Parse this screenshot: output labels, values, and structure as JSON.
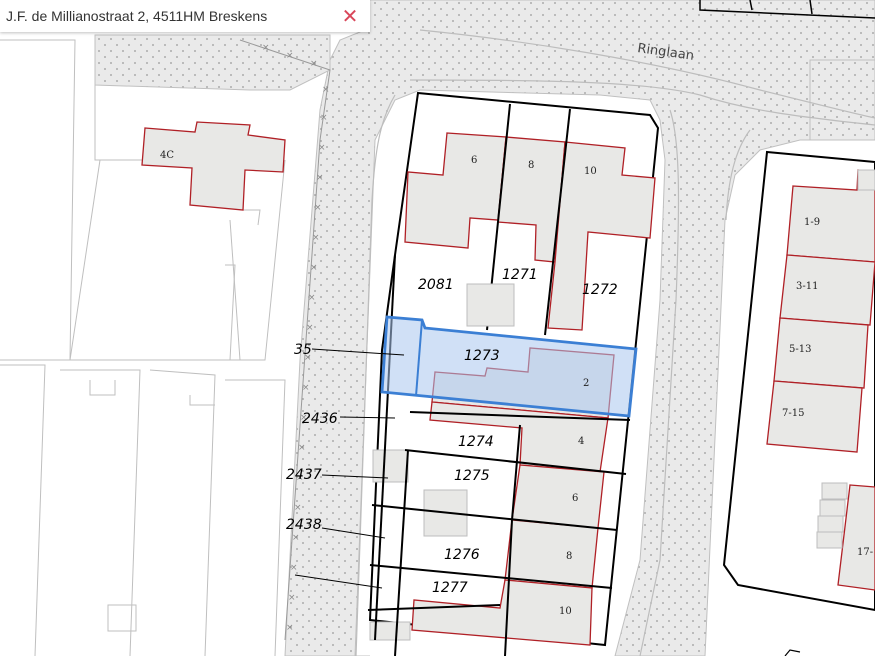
{
  "search": {
    "address": "J.F. de Millianostraat 2, 4511HM Breskens",
    "close_icon": "close-icon",
    "close_color": "#d9475a"
  },
  "map": {
    "street_name": "Ringlaan",
    "selected_parcel": "1273",
    "colors": {
      "selection_fill": "#cfe0f7",
      "selection_stroke": "#3b7fd4",
      "building_fill": "#e8e8e6",
      "building_stroke": "#b02026",
      "public_space": "#e9e9e9"
    },
    "parcel_labels": [
      "2081",
      "1271",
      "1272",
      "1273",
      "1274",
      "1275",
      "1276",
      "1277",
      "2436",
      "35",
      "2437",
      "2438"
    ],
    "house_numbers": [
      "4C",
      "6",
      "8",
      "10",
      "2",
      "4",
      "6",
      "8",
      "10",
      "1-9",
      "3-11",
      "5-13",
      "7-15",
      "17-"
    ]
  }
}
